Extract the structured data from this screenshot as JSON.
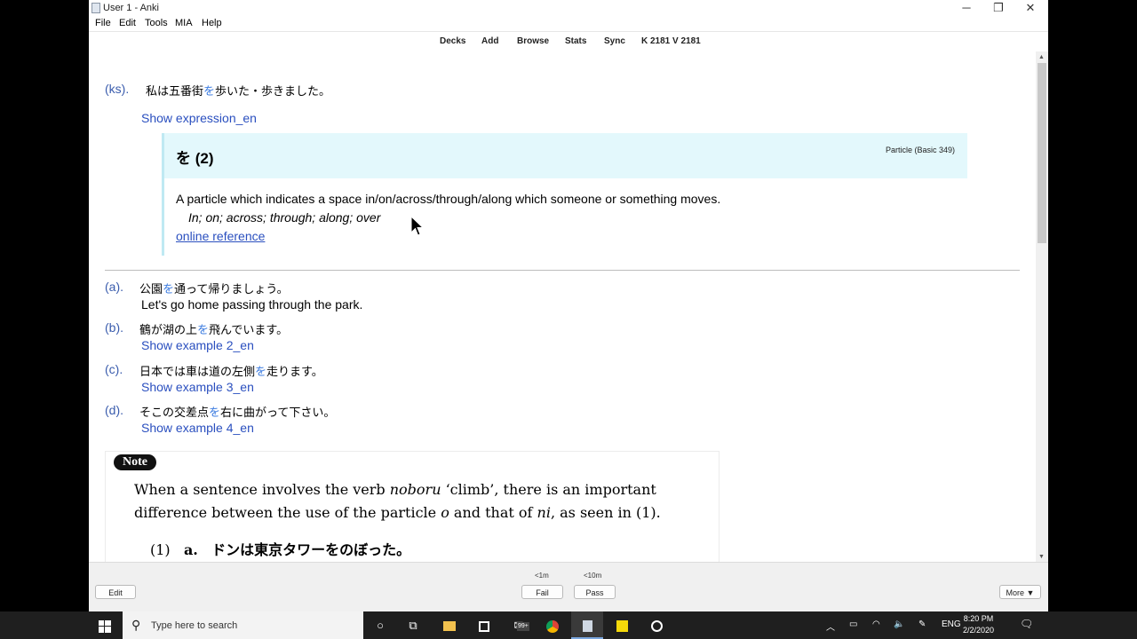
{
  "window": {
    "title": "User 1 - Anki",
    "controls": {
      "minimize": "─",
      "restore": "❐",
      "close": "✕"
    }
  },
  "menu": [
    "File",
    "Edit",
    "Tools",
    "MIA",
    "Help"
  ],
  "toolbar": {
    "decks": "Decks",
    "add": "Add",
    "browse": "Browse",
    "stats": "Stats",
    "sync": "Sync",
    "counts": "K 2181 V 2181"
  },
  "card": {
    "key_sentence": {
      "label": "(ks).",
      "jp_before": "私は五番街",
      "particle": "を",
      "jp_after": "歩いた・歩きました。",
      "show_link": "Show expression_en"
    },
    "particle": {
      "title": "を (2)",
      "tag": "Particle (Basic 349)",
      "meaning": "A particle which indicates a space in/on/across/through/along which someone or something moves.",
      "english": "In; on; across; through; along; over",
      "reference": "online reference"
    },
    "examples": [
      {
        "label": "(a).",
        "jp_before": "公園",
        "particle": "を",
        "jp_after": "通って帰りましょう。",
        "sub": "Let's go home passing through the park.",
        "sub_is_link": false
      },
      {
        "label": "(b).",
        "jp_before": "鶴が湖の上",
        "particle": "を",
        "jp_after": "飛んでいます。",
        "sub": "Show example 2_en",
        "sub_is_link": true
      },
      {
        "label": "(c).",
        "jp_before": "日本では車は道の左側",
        "particle": "を",
        "jp_after": "走ります。",
        "sub": "Show example 3_en",
        "sub_is_link": true
      },
      {
        "label": "(d).",
        "jp_before": "そこの交差点",
        "particle": "を",
        "jp_after": "右に曲がって下さい。",
        "sub": "Show example 4_en",
        "sub_is_link": true
      }
    ],
    "note": {
      "badge": "Note",
      "line1_a": "When a sentence involves the verb ",
      "line1_b": "noboru",
      "line1_c": " ‘climb’, there is an important",
      "line2_a": "difference between the use of the particle ",
      "line2_b": "o",
      "line2_c": " and that of ",
      "line2_d": "ni",
      "line2_e": ", as seen in (1).",
      "ex_num": "(1)",
      "ex_letter": "a.",
      "ex_text": "ドンは東京タワーをのぼった。"
    }
  },
  "bottom": {
    "edit": "Edit",
    "fail": "Fail",
    "fail_time": "<1m",
    "pass": "Pass",
    "pass_time": "<10m",
    "more": "More ▼"
  },
  "taskbar": {
    "search_placeholder": "Type here to search",
    "store_badge": "99+",
    "language": "ENG",
    "time": "8:20 PM",
    "date": "2/2/2020"
  },
  "colors": {
    "label_blue": "#3a5cad",
    "particle_highlight": "#3b7be0",
    "link_blue": "#2a4fbf",
    "particle_header_bg": "#e3f8fc"
  }
}
